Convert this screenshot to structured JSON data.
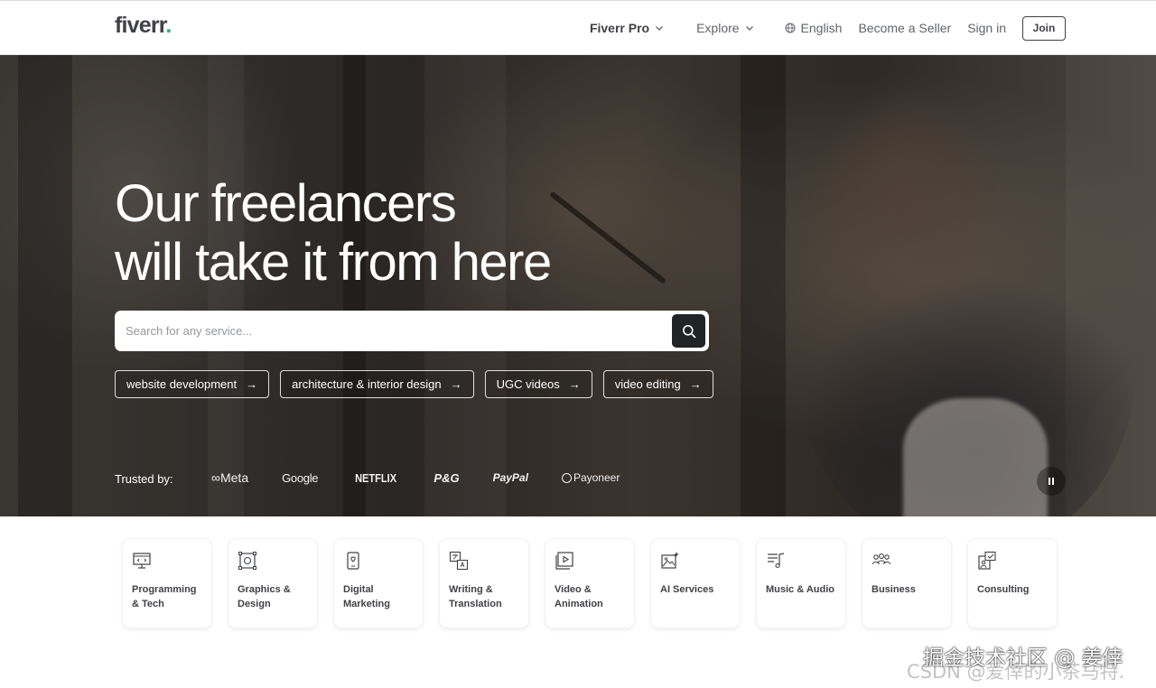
{
  "header": {
    "logo_text": "fiverr",
    "logo_dot": ".",
    "nav": {
      "pro": "Fiverr Pro",
      "explore": "Explore",
      "language": "English",
      "become_seller": "Become a Seller",
      "sign_in": "Sign in",
      "join": "Join"
    }
  },
  "hero": {
    "title_line1": "Our freelancers",
    "title_line2": "will take it from here",
    "search": {
      "placeholder": "Search for any service..."
    },
    "chips": [
      {
        "label": "website development",
        "arrow": "→"
      },
      {
        "label": "architecture & interior design",
        "arrow": "→"
      },
      {
        "label": "UGC videos",
        "arrow": "→"
      },
      {
        "label": "video editing",
        "arrow": "→"
      }
    ],
    "trusted_by": "Trusted by:",
    "brands": [
      "Meta",
      "Google",
      "NETFLIX",
      "P&G",
      "PayPal",
      "Payoneer"
    ],
    "meta_symbol": "∞"
  },
  "categories": [
    {
      "icon": "monitor-icon",
      "line1": "Programming",
      "line2": "& Tech"
    },
    {
      "icon": "design-grid-icon",
      "line1": "Graphics &",
      "line2": "Design"
    },
    {
      "icon": "phone-heart-icon",
      "line1": "Digital",
      "line2": "Marketing"
    },
    {
      "icon": "translate-icon",
      "line1": "Writing &",
      "line2": "Translation"
    },
    {
      "icon": "video-play-icon",
      "line1": "Video &",
      "line2": "Animation"
    },
    {
      "icon": "ai-image-icon",
      "line1": "AI Services",
      "line2": ""
    },
    {
      "icon": "music-icon",
      "line1": "Music & Audio",
      "line2": ""
    },
    {
      "icon": "people-icon",
      "line1": "Business",
      "line2": ""
    },
    {
      "icon": "consulting-icon",
      "line1": "Consulting",
      "line2": ""
    }
  ],
  "watermark": {
    "line1": "掘金技术社区 @ 姜倖",
    "line2": "CSDN @爱倖的小茶马特."
  },
  "colors": {
    "brand_green": "#1dbf73",
    "text_dark": "#404145",
    "search_button": "#222325"
  }
}
